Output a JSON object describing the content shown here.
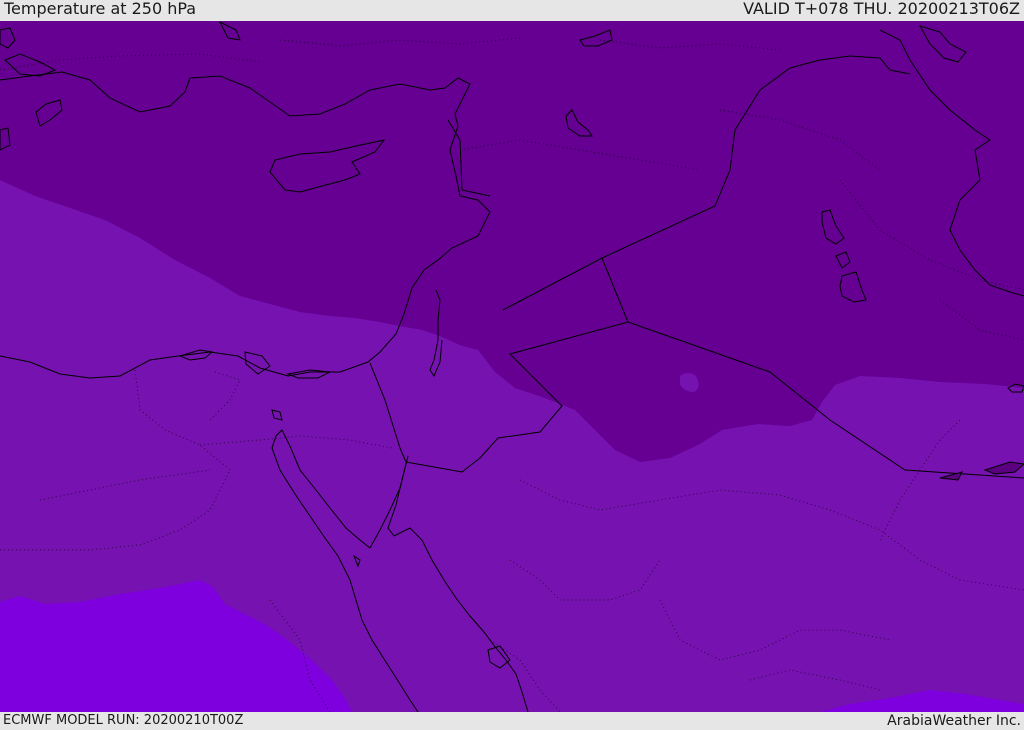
{
  "header": {
    "title": "Temperature at 250 hPa",
    "valid_time": "VALID T+078 THU. 20200213T06Z"
  },
  "footer": {
    "model_run": "ECMWF MODEL RUN: 20200210T00Z",
    "credit": "ArabiaWeather Inc."
  },
  "colors": {
    "band_coldest": "#650093",
    "band_mid": "#7612b0",
    "band_warm": "#7f00de",
    "coastline": "#000000",
    "background": "#e6e6e6"
  }
}
